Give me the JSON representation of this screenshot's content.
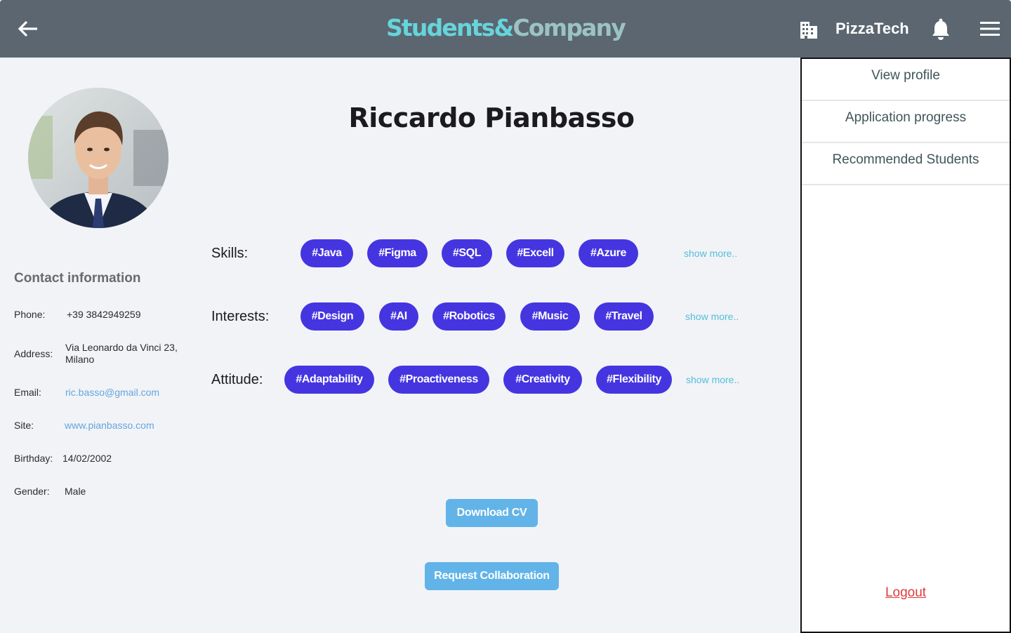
{
  "header": {
    "logo_part1": "Students&",
    "logo_part2": "Company",
    "company_name": "PizzaTech",
    "icons": {
      "back": "arrow-left-icon",
      "company": "building-icon",
      "notifications": "bell-icon",
      "menu": "hamburger-menu-icon"
    }
  },
  "profile": {
    "name": "Riccardo Pianbasso"
  },
  "contact": {
    "title": "Contact information",
    "phone_label": "Phone:",
    "phone": "+39 3842949259",
    "address_label": "Address:",
    "address_line1": "Via Leonardo da Vinci 23,",
    "address_line2": "Milano",
    "email_label": "Email:",
    "email": "ric.basso@gmail.com",
    "site_label": "Site:",
    "site": "www.pianbasso.com",
    "birthday_label": "Birthday:",
    "birthday": "14/02/2002",
    "gender_label": "Gender:",
    "gender": "Male"
  },
  "skills": {
    "label": "Skills:",
    "tags": [
      "#Java",
      "#Figma",
      "#SQL",
      "#Excell",
      "#Azure"
    ],
    "show_more": "show more.."
  },
  "interests": {
    "label": "Interests:",
    "tags": [
      "#Design",
      "#AI",
      "#Robotics",
      "#Music",
      "#Travel"
    ],
    "show_more": "show more.."
  },
  "attitude": {
    "label": "Attitude:",
    "tags": [
      "#Adaptability",
      "#Proactiveness",
      "#Creativity",
      "#Flexibility"
    ],
    "show_more": "show more.."
  },
  "actions": {
    "download_cv": "Download CV",
    "request_collaboration": "Request Collaboration"
  },
  "side_menu": {
    "items": [
      "View profile",
      "Application progress",
      "Recommended Students"
    ],
    "logout": "Logout"
  },
  "colors": {
    "header_bg": "#5b6670",
    "tag_bg": "#4535e0",
    "button_bg": "#62b4e8",
    "link": "#62a6dd",
    "logout": "#e03a3a"
  }
}
